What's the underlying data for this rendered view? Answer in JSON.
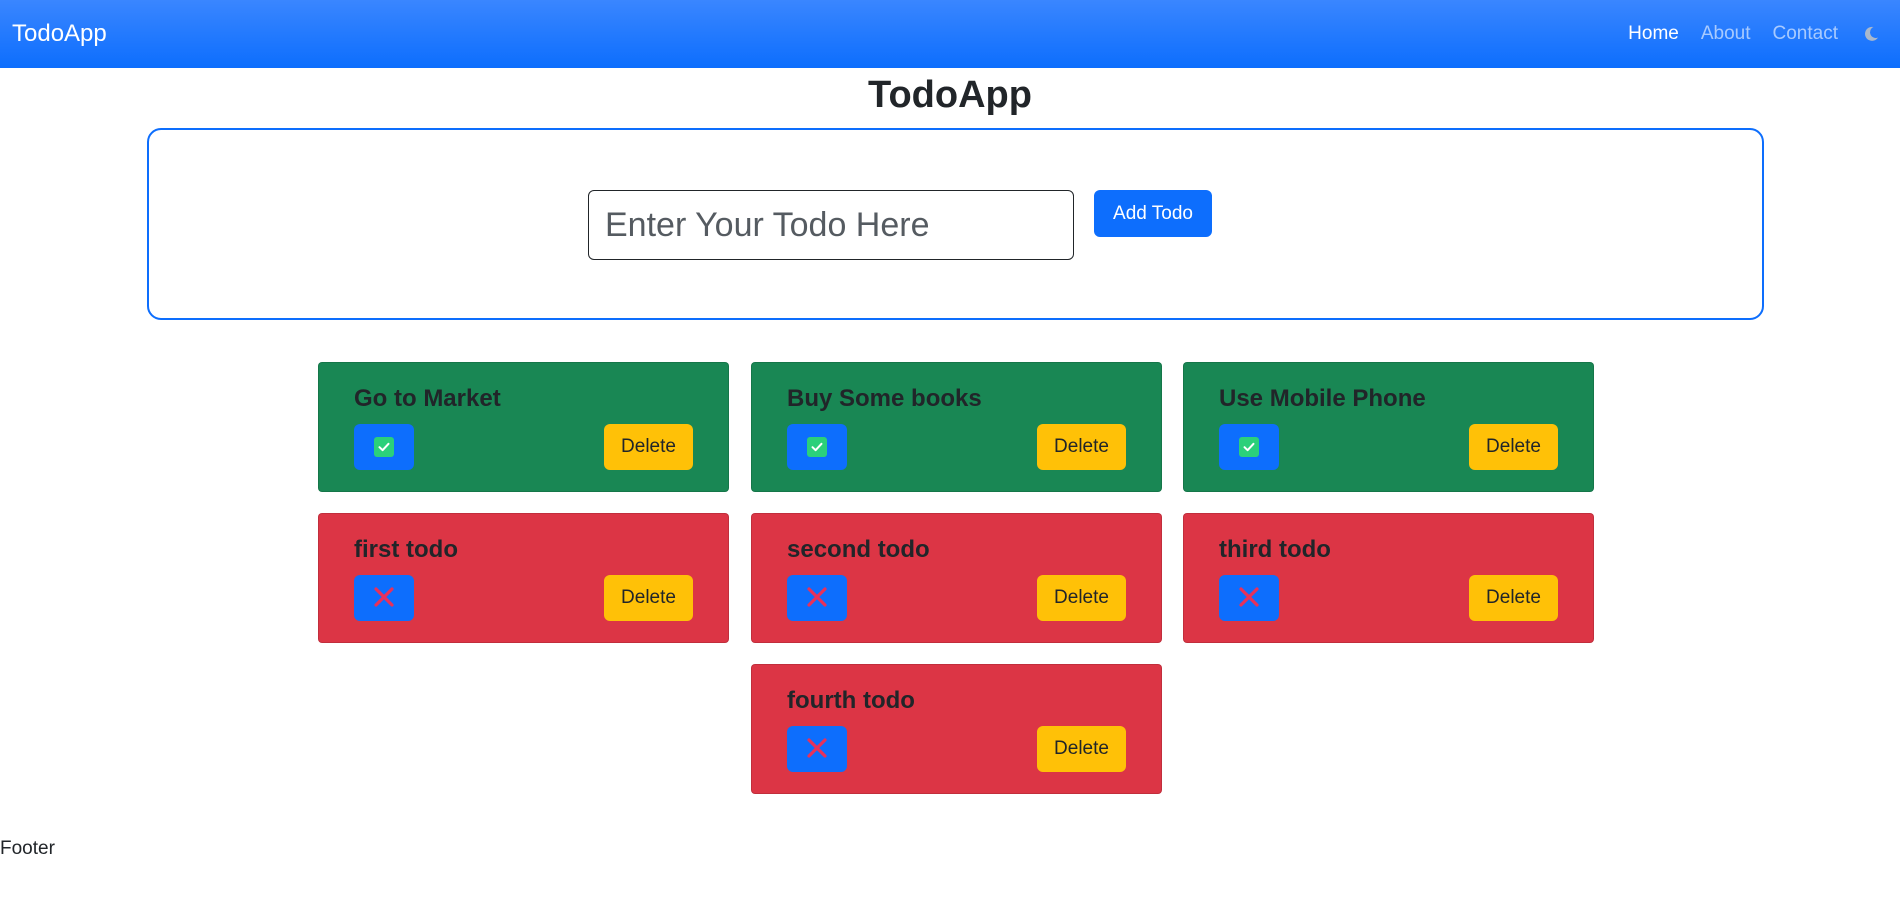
{
  "navbar": {
    "brand": "TodoApp",
    "links": [
      {
        "label": "Home",
        "active": true
      },
      {
        "label": "About",
        "active": false
      },
      {
        "label": "Contact",
        "active": false
      }
    ],
    "theme_icon": "moon-icon"
  },
  "page_title": "TodoApp",
  "form": {
    "placeholder": "Enter Your Todo Here",
    "value": "",
    "add_label": "Add Todo"
  },
  "todos": [
    {
      "title": "Go to Market",
      "completed": true,
      "delete_label": "Delete"
    },
    {
      "title": "Buy Some books",
      "completed": true,
      "delete_label": "Delete"
    },
    {
      "title": "Use Mobile Phone",
      "completed": true,
      "delete_label": "Delete"
    },
    {
      "title": "first todo",
      "completed": false,
      "delete_label": "Delete"
    },
    {
      "title": "second todo",
      "completed": false,
      "delete_label": "Delete"
    },
    {
      "title": "third todo",
      "completed": false,
      "delete_label": "Delete"
    },
    {
      "title": "fourth todo",
      "completed": false,
      "delete_label": "Delete"
    }
  ],
  "colors": {
    "primary": "#0d6efd",
    "success": "#198754",
    "danger": "#dc3545",
    "warning": "#ffc107"
  },
  "footer": "Footer"
}
